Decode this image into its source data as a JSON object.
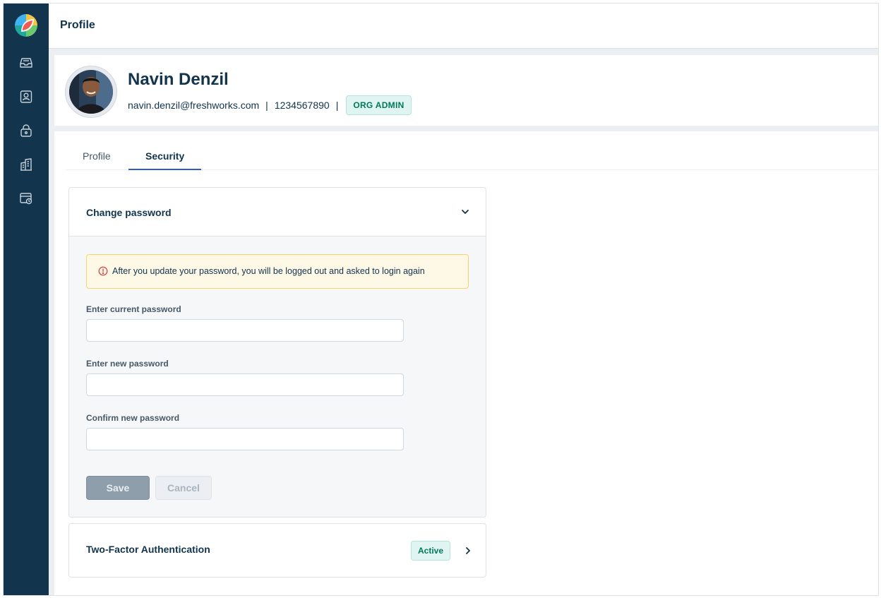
{
  "header": {
    "title": "Profile"
  },
  "sidebar": {
    "logo": "freshworks-logo",
    "items": [
      {
        "icon": "inbox-icon"
      },
      {
        "icon": "user-contact-icon"
      },
      {
        "icon": "lock-icon"
      },
      {
        "icon": "building-icon"
      },
      {
        "icon": "calendar-clock-icon"
      }
    ]
  },
  "profile": {
    "name": "Navin Denzil",
    "email": "navin.denzil@freshworks.com",
    "separator": "|",
    "phone": "1234567890",
    "role": "ORG ADMIN"
  },
  "tabs": [
    {
      "label": "Profile",
      "active": false
    },
    {
      "label": "Security",
      "active": true
    }
  ],
  "change_password": {
    "title": "Change password",
    "warning": "After you update your password, you will be logged out and asked to login again",
    "fields": [
      {
        "label": "Enter current password",
        "value": "",
        "placeholder": ""
      },
      {
        "label": "Enter new password",
        "value": "",
        "placeholder": ""
      },
      {
        "label": "Confirm new password",
        "value": "",
        "placeholder": ""
      }
    ],
    "save_label": "Save",
    "cancel_label": "Cancel"
  },
  "two_factor": {
    "title": "Two-Factor Authentication",
    "status": "Active"
  },
  "colors": {
    "sidebar": "#12344d",
    "accent": "#2c5cc5",
    "badge_text": "#00795b",
    "badge_bg": "#e0f5f1",
    "warning_bg": "#fef8e6",
    "warning_border": "#f7d46b",
    "warning_icon": "#e43538"
  }
}
